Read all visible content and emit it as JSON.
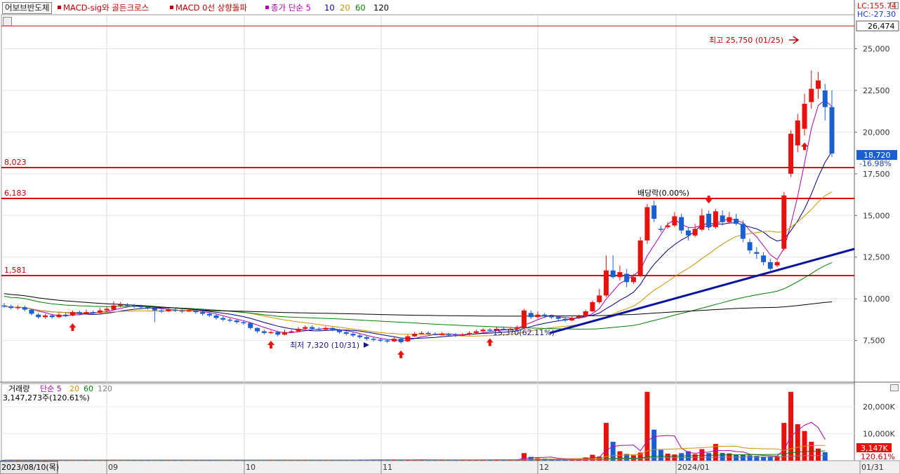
{
  "toolbar": {
    "group_button": "어보브반도체",
    "indicators": [
      {
        "label": "MACD-sig와 골든크로스",
        "color": "#c00000"
      },
      {
        "label": "MACD 0선 상향돌파",
        "color": "#c00000"
      },
      {
        "label": "종가 단순 5",
        "color": "#b000b0"
      },
      {
        "label": "10",
        "color": "#000080"
      },
      {
        "label": "20",
        "color": "#d09000"
      },
      {
        "label": "60",
        "color": "#008000"
      },
      {
        "label": "120",
        "color": "#000000"
      }
    ]
  },
  "right_info": {
    "lc": "LC:155.74",
    "hc": "HC:-27.30",
    "top_price": "26,474",
    "current_price": "18,720",
    "current_change": "-16.98%"
  },
  "price_lines": [
    "8,023",
    "6,183",
    "1,581"
  ],
  "annotations": {
    "high": "최고 25,750 (01/25)",
    "low": "최저 7,320 (10/31)",
    "mid": "15,3?0(62.11%)",
    "ex_dividend": "배당락(0.00%)"
  },
  "volume_panel": {
    "title": "거래량",
    "ma_label": "단순 5",
    "ma_periods": [
      {
        "label": "20",
        "color": "#d09000"
      },
      {
        "label": "60",
        "color": "#008000"
      },
      {
        "label": "120",
        "color": "#808080"
      }
    ],
    "value_text": "3,147,273주(120.61%)",
    "current_value": "3,147K",
    "current_pct": "120.61%"
  },
  "date_axis": {
    "start_label": "2023/08/10(목)",
    "end_label": "01/31",
    "ticks": [
      "09",
      "10",
      "11",
      "12",
      "2024/01"
    ]
  },
  "colors": {
    "up": "#e8120c",
    "down": "#1a5fd0",
    "ref_line": "#e00000",
    "trend_line": "#0a14a0"
  },
  "chart_data": {
    "type": "candlestick",
    "title": "어보브반도체",
    "price_axis": {
      "ticks": [
        7500,
        10000,
        12500,
        15000,
        17500,
        20000,
        22500,
        25000
      ],
      "ylim": [
        5000,
        27000
      ]
    },
    "volume_axis": {
      "ticks": [
        10000,
        20000
      ],
      "unit": "K"
    },
    "high": {
      "value": 25750,
      "date": "01/25"
    },
    "low": {
      "value": 7320,
      "date": "10/31"
    },
    "current": {
      "value": 18720,
      "change_pct": -16.98
    },
    "candles": [
      [
        9600,
        9550,
        9750,
        9450
      ],
      [
        9550,
        9450,
        9650,
        9350
      ],
      [
        9450,
        9500,
        9600,
        9350
      ],
      [
        9500,
        9350,
        9600,
        9250
      ],
      [
        9350,
        9100,
        9400,
        9000
      ],
      [
        9050,
        8900,
        9150,
        8800
      ],
      [
        8900,
        9000,
        9100,
        8800
      ],
      [
        9000,
        8900,
        9100,
        8800
      ],
      [
        8900,
        9050,
        9150,
        8850
      ],
      [
        9050,
        9000,
        9150,
        8900
      ],
      [
        9000,
        9200,
        9300,
        8950
      ],
      [
        9200,
        9100,
        9300,
        9000
      ],
      [
        9100,
        9200,
        9350,
        9050
      ],
      [
        9200,
        9150,
        9300,
        9050
      ],
      [
        9150,
        9300,
        9450,
        9100
      ],
      [
        9300,
        9400,
        9550,
        9200
      ],
      [
        9350,
        9600,
        9850,
        9300
      ],
      [
        9600,
        9650,
        9800,
        9500
      ],
      [
        9650,
        9600,
        9750,
        9500
      ],
      [
        9600,
        9550,
        9700,
        9450
      ],
      [
        9550,
        9500,
        9650,
        9400
      ],
      [
        9500,
        9450,
        9600,
        9350
      ],
      [
        9450,
        9300,
        9500,
        8600
      ],
      [
        9300,
        9250,
        9400,
        9150
      ],
      [
        9250,
        9350,
        9450,
        9200
      ],
      [
        9350,
        9300,
        9450,
        9200
      ],
      [
        9300,
        9250,
        9400,
        9150
      ],
      [
        9250,
        9300,
        9450,
        9200
      ],
      [
        9300,
        9200,
        9400,
        9100
      ],
      [
        9200,
        9100,
        9300,
        9000
      ],
      [
        9100,
        9000,
        9200,
        8900
      ],
      [
        9000,
        8850,
        9100,
        8750
      ],
      [
        8850,
        8750,
        8950,
        8650
      ],
      [
        8750,
        8700,
        8850,
        8600
      ],
      [
        8700,
        8600,
        8800,
        8500
      ],
      [
        8600,
        8550,
        8700,
        8450
      ],
      [
        8550,
        8250,
        8600,
        8150
      ],
      [
        8250,
        8050,
        8300,
        7950
      ],
      [
        8050,
        7950,
        8150,
        7850
      ],
      [
        7950,
        8000,
        8100,
        7900
      ],
      [
        8000,
        7850,
        8100,
        7750
      ],
      [
        7850,
        8000,
        8150,
        7800
      ],
      [
        8000,
        8050,
        8150,
        7950
      ],
      [
        8050,
        8200,
        8300,
        8000
      ],
      [
        8200,
        8300,
        8400,
        8150
      ],
      [
        8300,
        8200,
        8400,
        8100
      ],
      [
        8200,
        8150,
        8300,
        8050
      ],
      [
        8150,
        8250,
        8350,
        8100
      ],
      [
        8250,
        8150,
        8300,
        8050
      ],
      [
        8150,
        8000,
        8200,
        7900
      ],
      [
        8000,
        7900,
        8100,
        7800
      ],
      [
        7900,
        7800,
        8000,
        7700
      ],
      [
        7800,
        7700,
        7900,
        7600
      ],
      [
        7700,
        7600,
        7800,
        7500
      ],
      [
        7600,
        7550,
        7700,
        7450
      ],
      [
        7550,
        7500,
        7650,
        7400
      ],
      [
        7500,
        7450,
        7600,
        7350
      ],
      [
        7450,
        7600,
        7700,
        7400
      ],
      [
        7600,
        7400,
        7650,
        7320
      ],
      [
        7450,
        7750,
        7850,
        7400
      ],
      [
        7750,
        7900,
        8000,
        7700
      ],
      [
        7900,
        7950,
        8050,
        7850
      ],
      [
        7950,
        7900,
        8050,
        7850
      ],
      [
        7900,
        7850,
        8000,
        7800
      ],
      [
        7850,
        7900,
        8000,
        7800
      ],
      [
        7900,
        7850,
        7950,
        7750
      ],
      [
        7850,
        7800,
        7950,
        7700
      ],
      [
        7800,
        7850,
        7950,
        7750
      ],
      [
        7850,
        7950,
        8050,
        7800
      ],
      [
        7950,
        8050,
        8150,
        7900
      ],
      [
        8050,
        8150,
        8250,
        8000
      ],
      [
        8150,
        8100,
        8250,
        8050
      ],
      [
        8100,
        8200,
        8300,
        8050
      ],
      [
        8200,
        8150,
        8300,
        8100
      ],
      [
        8150,
        8200,
        8300,
        8100
      ],
      [
        8200,
        8300,
        8400,
        8150
      ],
      [
        8250,
        9300,
        9400,
        8200
      ],
      [
        9150,
        8900,
        9300,
        8800
      ],
      [
        8900,
        9050,
        9250,
        8800
      ],
      [
        9050,
        8950,
        9150,
        8850
      ],
      [
        8950,
        8900,
        9050,
        8800
      ],
      [
        8900,
        8800,
        9000,
        8700
      ],
      [
        8800,
        8700,
        8900,
        8600
      ],
      [
        8700,
        8850,
        8950,
        8650
      ],
      [
        8850,
        8950,
        9050,
        8800
      ],
      [
        8950,
        9250,
        9350,
        8900
      ],
      [
        9250,
        9800,
        9900,
        9200
      ],
      [
        9800,
        10200,
        10600,
        9700
      ],
      [
        10200,
        11700,
        12600,
        10100
      ],
      [
        11700,
        11300,
        12600,
        11200
      ],
      [
        11300,
        11600,
        12000,
        11100
      ],
      [
        11500,
        11000,
        11800,
        10700
      ],
      [
        11000,
        11300,
        11500,
        10900
      ],
      [
        11400,
        13500,
        13700,
        11300
      ],
      [
        13500,
        15500,
        15700,
        13300
      ],
      [
        15600,
        14800,
        15900,
        14600
      ],
      [
        14200,
        14150,
        14400,
        14000
      ],
      [
        14300,
        14400,
        14600,
        14200
      ],
      [
        14400,
        14950,
        15200,
        14300
      ],
      [
        14900,
        14100,
        15100,
        13900
      ],
      [
        14100,
        13800,
        14300,
        13500
      ],
      [
        13800,
        14200,
        14500,
        13700
      ],
      [
        14150,
        15000,
        15400,
        14050
      ],
      [
        15100,
        14300,
        15300,
        14100
      ],
      [
        14300,
        15250,
        15400,
        14200
      ],
      [
        15000,
        14600,
        15300,
        14400
      ],
      [
        14600,
        14900,
        15200,
        14500
      ],
      [
        14800,
        14500,
        15100,
        14400
      ],
      [
        14500,
        13600,
        14700,
        13400
      ],
      [
        13400,
        12900,
        13600,
        12700
      ],
      [
        12800,
        12700,
        13100,
        12400
      ],
      [
        12600,
        12200,
        12800,
        12000
      ],
      [
        12200,
        11800,
        12400,
        11700
      ],
      [
        12000,
        12200,
        12300,
        11900
      ],
      [
        13000,
        16200,
        16400,
        12900
      ],
      [
        17500,
        19900,
        20100,
        17300
      ],
      [
        19200,
        20700,
        21100,
        18800
      ],
      [
        20200,
        21700,
        22300,
        19800
      ],
      [
        21800,
        22600,
        23700,
        21400
      ],
      [
        22600,
        23100,
        23600,
        22000
      ],
      [
        22500,
        21500,
        22900,
        20700
      ],
      [
        21500,
        18720,
        22500,
        18500
      ]
    ],
    "volume_k": [
      260,
      240,
      220,
      250,
      210,
      230,
      200,
      240,
      220,
      230,
      260,
      240,
      230,
      220,
      250,
      260,
      300,
      280,
      240,
      230,
      220,
      210,
      350,
      200,
      240,
      220,
      210,
      250,
      230,
      220,
      210,
      230,
      260,
      240,
      220,
      210,
      300,
      320,
      260,
      240,
      230,
      280,
      250,
      270,
      290,
      260,
      240,
      260,
      250,
      270,
      280,
      300,
      310,
      330,
      300,
      280,
      290,
      320,
      350,
      400,
      380,
      320,
      300,
      290,
      280,
      270,
      260,
      280,
      300,
      320,
      350,
      330,
      340,
      320,
      330,
      360,
      2800,
      1400,
      900,
      800,
      700,
      650,
      600,
      700,
      800,
      1200,
      2200,
      1500,
      14000,
      7000,
      3500,
      2500,
      2000,
      3000,
      25500,
      11500,
      4000,
      2600,
      2300,
      2800,
      3500,
      2400,
      4300,
      2800,
      6200,
      2900,
      2700,
      2300,
      2200,
      2000,
      1800,
      1500,
      1600,
      1700,
      14000,
      25500,
      13500,
      11000,
      7000,
      4500,
      3147
    ],
    "ma_series": [
      {
        "period": 5,
        "color": "#b000b0",
        "line": "line"
      },
      {
        "period": 10,
        "color": "#000080",
        "line": "line"
      },
      {
        "period": 20,
        "color": "#d09000",
        "line": "line"
      },
      {
        "period": 60,
        "color": "#008000",
        "line": "line"
      },
      {
        "period": 120,
        "color": "#000000",
        "line": "line"
      }
    ],
    "buy_signals_idx": [
      10,
      39,
      58,
      71,
      117
    ],
    "sell_signals_idx": [
      103
    ]
  }
}
